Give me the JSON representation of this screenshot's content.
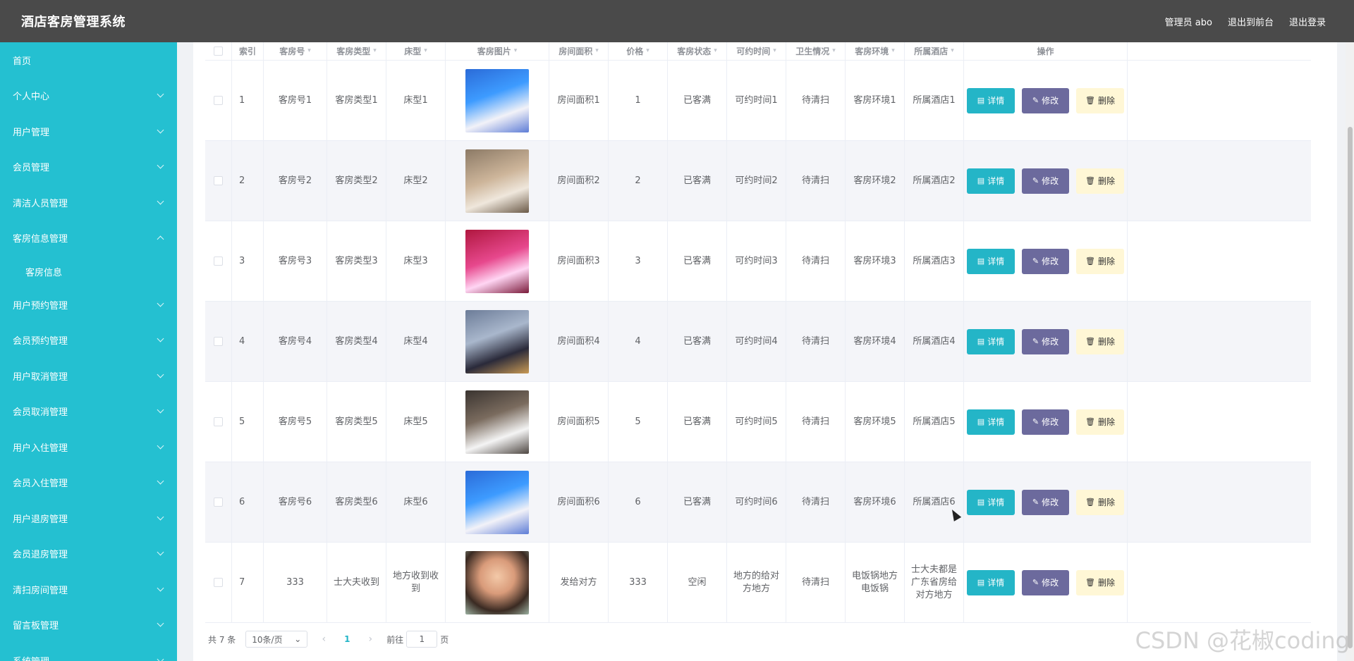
{
  "header": {
    "title": "酒店客房管理系统",
    "admin": "管理员 abo",
    "back_front": "退出到前台",
    "logout": "退出登录"
  },
  "sidebar": {
    "items": [
      {
        "label": "首页",
        "chevron": "none"
      },
      {
        "label": "个人中心",
        "chevron": "down"
      },
      {
        "label": "用户管理",
        "chevron": "down"
      },
      {
        "label": "会员管理",
        "chevron": "down"
      },
      {
        "label": "清洁人员管理",
        "chevron": "down"
      },
      {
        "label": "客房信息管理",
        "chevron": "up"
      },
      {
        "label": "客房信息",
        "chevron": "none",
        "sub": true
      },
      {
        "label": "用户预约管理",
        "chevron": "down"
      },
      {
        "label": "会员预约管理",
        "chevron": "down"
      },
      {
        "label": "用户取消管理",
        "chevron": "down"
      },
      {
        "label": "会员取消管理",
        "chevron": "down"
      },
      {
        "label": "用户入住管理",
        "chevron": "down"
      },
      {
        "label": "会员入住管理",
        "chevron": "down"
      },
      {
        "label": "用户退房管理",
        "chevron": "down"
      },
      {
        "label": "会员退房管理",
        "chevron": "down"
      },
      {
        "label": "清扫房间管理",
        "chevron": "down"
      },
      {
        "label": "留言板管理",
        "chevron": "down"
      },
      {
        "label": "系统管理",
        "chevron": "down"
      }
    ]
  },
  "table": {
    "columns": [
      "索引",
      "客房号",
      "客房类型",
      "床型",
      "客房图片",
      "房间面积",
      "价格",
      "客房状态",
      "可约时间",
      "卫生情况",
      "客房环境",
      "所属酒店",
      "操作"
    ],
    "rows": [
      {
        "idx": "1",
        "room": "客房号1",
        "type": "客房类型1",
        "bed": "床型1",
        "area": "房间面积1",
        "price": "1",
        "status": "已客满",
        "time": "可约时间1",
        "clean": "待清扫",
        "env": "客房环境1",
        "hotel": "所属酒店1"
      },
      {
        "idx": "2",
        "room": "客房号2",
        "type": "客房类型2",
        "bed": "床型2",
        "area": "房间面积2",
        "price": "2",
        "status": "已客满",
        "time": "可约时间2",
        "clean": "待清扫",
        "env": "客房环境2",
        "hotel": "所属酒店2"
      },
      {
        "idx": "3",
        "room": "客房号3",
        "type": "客房类型3",
        "bed": "床型3",
        "area": "房间面积3",
        "price": "3",
        "status": "已客满",
        "time": "可约时间3",
        "clean": "待清扫",
        "env": "客房环境3",
        "hotel": "所属酒店3"
      },
      {
        "idx": "4",
        "room": "客房号4",
        "type": "客房类型4",
        "bed": "床型4",
        "area": "房间面积4",
        "price": "4",
        "status": "已客满",
        "time": "可约时间4",
        "clean": "待清扫",
        "env": "客房环境4",
        "hotel": "所属酒店4"
      },
      {
        "idx": "5",
        "room": "客房号5",
        "type": "客房类型5",
        "bed": "床型5",
        "area": "房间面积5",
        "price": "5",
        "status": "已客满",
        "time": "可约时间5",
        "clean": "待清扫",
        "env": "客房环境5",
        "hotel": "所属酒店5"
      },
      {
        "idx": "6",
        "room": "客房号6",
        "type": "客房类型6",
        "bed": "床型6",
        "area": "房间面积6",
        "price": "6",
        "status": "已客满",
        "time": "可约时间6",
        "clean": "待清扫",
        "env": "客房环境6",
        "hotel": "所属酒店6"
      },
      {
        "idx": "7",
        "room": "333",
        "type": "士大夫收到",
        "bed": "地方收到收到",
        "area": "发给对方",
        "price": "333",
        "status": "空闲",
        "time": "地方的给对方地方",
        "clean": "待清扫",
        "env": "电饭锅地方电饭锅",
        "hotel": "士大夫都是广东省房给对方地方"
      }
    ],
    "actions": {
      "detail": "详情",
      "edit": "修改",
      "delete": "删除"
    }
  },
  "pager": {
    "total": "共 7 条",
    "page_size": "10条/页",
    "current": "1",
    "goto_prefix": "前往",
    "goto_value": "1",
    "goto_suffix": "页"
  },
  "watermark": "CSDN @花椒coding",
  "colors": {
    "sidebar": "#24c0d1",
    "header": "#4a4a4a",
    "detail_btn": "#24b5c7",
    "edit_btn": "#6c6a9d",
    "delete_btn": "#fff7d6"
  }
}
